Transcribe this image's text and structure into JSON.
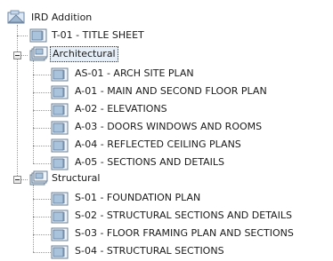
{
  "tree": {
    "root": {
      "label": "IRD Addition",
      "icon": "project-icon"
    },
    "root_children": [
      {
        "label": "T-01 - TITLE SHEET",
        "icon": "sheet-icon"
      }
    ],
    "groups": [
      {
        "label": "Architectural",
        "icon": "sheet-set-icon",
        "expanded": true,
        "selected": true,
        "items": [
          {
            "label": "AS-01 - ARCH SITE PLAN",
            "icon": "sheet-icon"
          },
          {
            "label": "A-01 - MAIN AND SECOND FLOOR PLAN",
            "icon": "sheet-icon"
          },
          {
            "label": "A-02 - ELEVATIONS",
            "icon": "sheet-icon"
          },
          {
            "label": "A-03 - DOORS WINDOWS AND ROOMS",
            "icon": "sheet-icon"
          },
          {
            "label": "A-04 - REFLECTED CEILING PLANS",
            "icon": "sheet-icon"
          },
          {
            "label": "A-05 - SECTIONS AND DETAILS",
            "icon": "sheet-icon"
          }
        ]
      },
      {
        "label": "Structural",
        "icon": "sheet-set-icon",
        "expanded": true,
        "selected": false,
        "items": [
          {
            "label": "S-01 - FOUNDATION PLAN",
            "icon": "sheet-icon"
          },
          {
            "label": "S-02 - STRUCTURAL SECTIONS AND DETAILS",
            "icon": "sheet-icon"
          },
          {
            "label": "S-03 - FLOOR FRAMING PLAN AND SECTIONS",
            "icon": "sheet-icon"
          },
          {
            "label": "S-04 - STRUCTURAL SECTIONS",
            "icon": "sheet-icon"
          }
        ]
      }
    ]
  }
}
